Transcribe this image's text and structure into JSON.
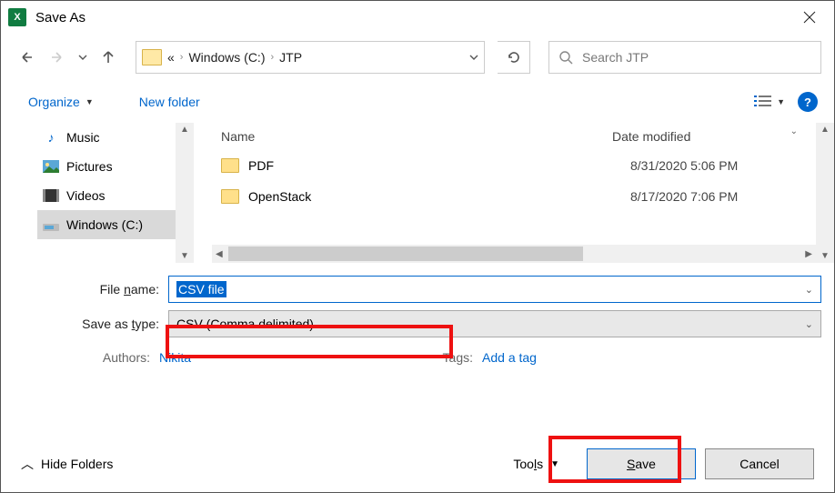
{
  "titlebar": {
    "title": "Save As"
  },
  "nav": {
    "crumb_prefix": "«",
    "crumb1": "Windows (C:)",
    "crumb2": "JTP"
  },
  "search": {
    "placeholder": "Search JTP"
  },
  "toolbar": {
    "organize": "Organize",
    "newfolder": "New folder"
  },
  "sidebar": {
    "items": [
      {
        "label": "Music"
      },
      {
        "label": "Pictures"
      },
      {
        "label": "Videos"
      },
      {
        "label": "Windows (C:)"
      }
    ]
  },
  "headers": {
    "name": "Name",
    "date": "Date modified"
  },
  "files": [
    {
      "name": "PDF",
      "date": "8/31/2020 5:06 PM"
    },
    {
      "name": "OpenStack",
      "date": "8/17/2020 7:06 PM"
    }
  ],
  "form": {
    "filename_label": "File name:",
    "filename_value": "CSV file",
    "type_label": "Save as type:",
    "type_value": "CSV (Comma delimited)",
    "authors_label": "Authors:",
    "authors_value": "Nikita",
    "tags_label": "Tags:",
    "tags_value": "Add a tag"
  },
  "bottom": {
    "hide": "Hide Folders",
    "tools": "Tools",
    "save": "Save",
    "cancel": "Cancel"
  }
}
